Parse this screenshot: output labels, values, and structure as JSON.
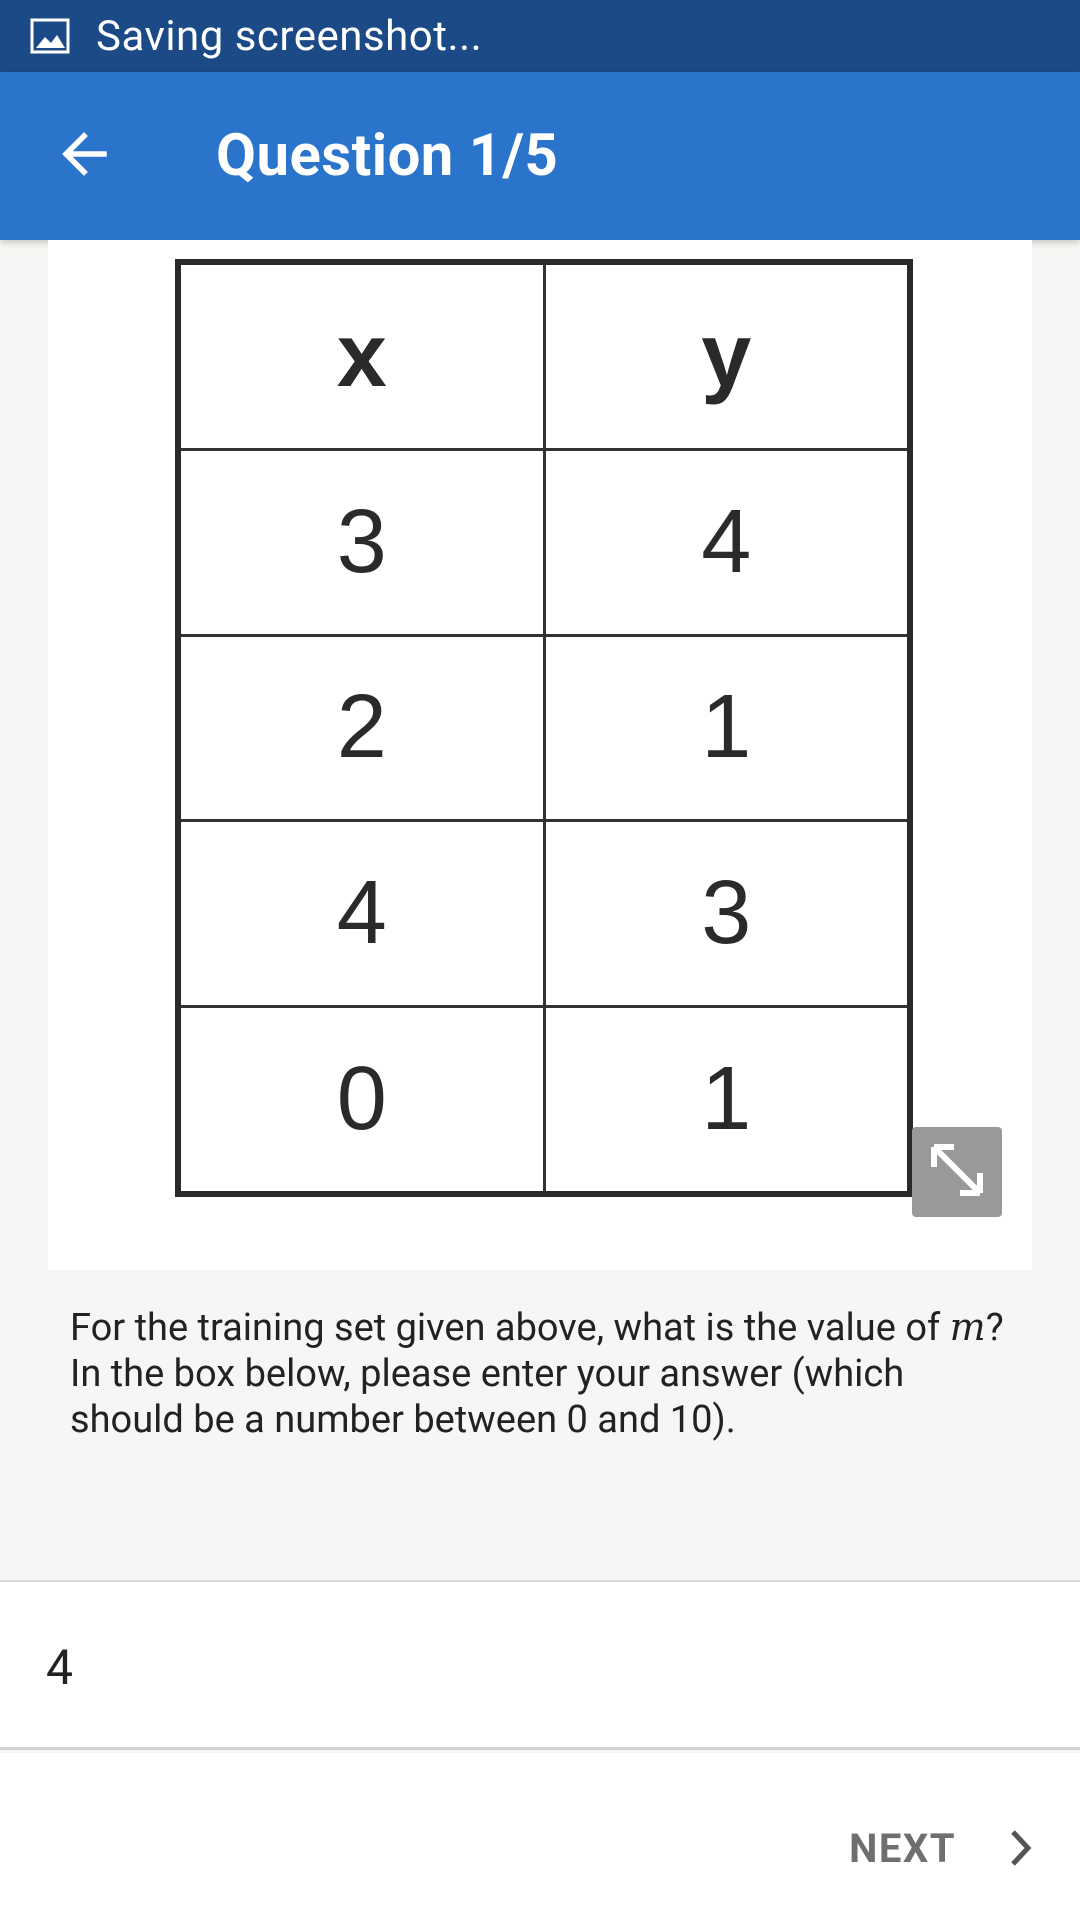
{
  "status_bar": {
    "icon": "image-icon",
    "text": "Saving screenshot..."
  },
  "app_bar": {
    "back_icon": "arrow-left-icon",
    "title": "Question 1/5"
  },
  "table": {
    "headers": [
      "x",
      "y"
    ],
    "rows": [
      [
        "3",
        "4"
      ],
      [
        "2",
        "1"
      ],
      [
        "4",
        "3"
      ],
      [
        "0",
        "1"
      ]
    ]
  },
  "expand_icon": "expand-arrows-icon",
  "question": {
    "part1": "For the training set given above, what is the value of",
    "variable": "m",
    "part2": "? In the box below, please enter your answer (which should be a number between 0 and 10)."
  },
  "answer": {
    "value": "4"
  },
  "footer": {
    "next_label": "NEXT",
    "next_icon": "chevron-right-icon"
  },
  "colors": {
    "status_bar": "#1b4a86",
    "app_bar": "#2b74cc",
    "background": "#f6f7f4"
  }
}
